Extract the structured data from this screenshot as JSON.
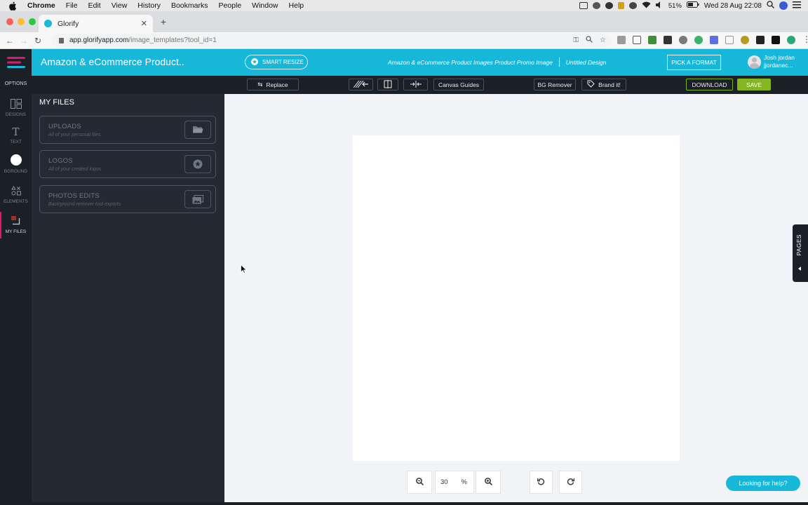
{
  "mac_menubar": {
    "app_name": "Chrome",
    "menus": [
      "File",
      "Edit",
      "View",
      "History",
      "Bookmarks",
      "People",
      "Window",
      "Help"
    ],
    "battery": "51%",
    "datetime": "Wed 28 Aug  22:08"
  },
  "browser": {
    "tab_title": "Glorify",
    "url_host": "app.glorifyapp.com",
    "url_path": "/image_templates?tool_id=1"
  },
  "header": {
    "project_title": "Amazon & eCommerce Product..",
    "smart_resize": "SMART RESIZE",
    "design_type": "Amazon & eCommerce Product Images Product Promo Image",
    "design_name": "Untitled Design",
    "pick_format": "PICK A FORMAT",
    "user_name": "Josh jordan",
    "user_handle": "jjordanec..."
  },
  "sidebar": {
    "options_label": "OPTIONS",
    "items": [
      {
        "label": "DESIGNS"
      },
      {
        "label": "TEXT"
      },
      {
        "label": "BGROUND"
      },
      {
        "label": "ELEMENTS"
      },
      {
        "label": "MY FILES"
      }
    ]
  },
  "toolbar": {
    "replace": "Replace",
    "canvas_guides": "Canvas Guides",
    "bg_remover": "BG Remover",
    "brand_it": "Brand it!",
    "download": "DOWNLOAD",
    "save": "SAVE"
  },
  "files_panel": {
    "title": "MY FILES",
    "cards": [
      {
        "title": "UPLOADS",
        "subtitle": "All of your personal files"
      },
      {
        "title": "LOGOS",
        "subtitle": "All of your created logos"
      },
      {
        "title": "PHOTOS EDITS",
        "subtitle": "Background remover tool exports"
      }
    ]
  },
  "canvas": {
    "pages_label": "PAGES",
    "zoom_value": "30",
    "zoom_unit": "%",
    "help_label": "Looking for help?"
  },
  "colors": {
    "accent_cyan": "#17b7d9",
    "save_green": "#84b71f",
    "active_pink": "#e0186b",
    "dark_bg": "#1b1f26"
  }
}
